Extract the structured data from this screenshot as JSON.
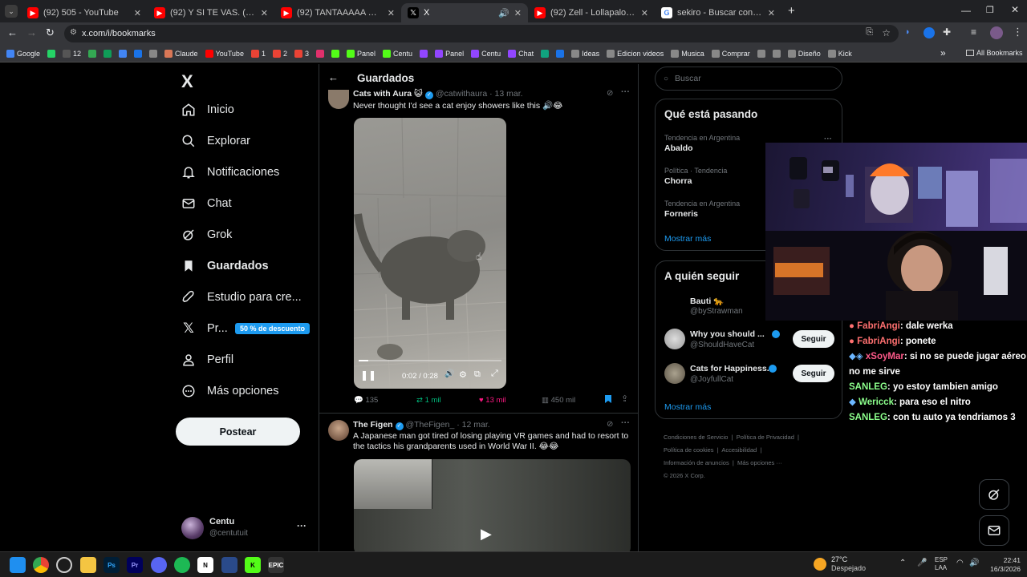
{
  "browser": {
    "tabs": [
      {
        "title": "(92) 505 - YouTube",
        "color": "#ff0000"
      },
      {
        "title": "(92) Y SI TE VAS. (VIDEO OFICIAL",
        "color": "#ff0000"
      },
      {
        "title": "(92) TANTAAAAA PLATAAA FT S",
        "color": "#ff0000"
      },
      {
        "title": "X",
        "color": "#000000"
      },
      {
        "title": "(92) Zell - Lollapalooza 2026 - Y",
        "color": "#ff0000"
      },
      {
        "title": "sekiro - Buscar con Google",
        "color": "#4285f4"
      }
    ],
    "new_tab": "+",
    "url": "x.com/i/bookmarks",
    "bookmarks": [
      {
        "label": "Google",
        "color": "#4285f4"
      },
      {
        "label": "",
        "color": "#25d366"
      },
      {
        "label": "12",
        "color": "#555"
      },
      {
        "label": "",
        "color": "#34a853"
      },
      {
        "label": "",
        "color": "#0f9d58"
      },
      {
        "label": "",
        "color": "#4285f4"
      },
      {
        "label": "",
        "color": "#1a73e8"
      },
      {
        "label": "",
        "color": "#888"
      },
      {
        "label": "Claude",
        "color": "#d97757"
      },
      {
        "label": "YouTube",
        "color": "#ff0000"
      },
      {
        "label": "1",
        "color": "#ea4335"
      },
      {
        "label": "2",
        "color": "#ea4335"
      },
      {
        "label": "3",
        "color": "#ea4335"
      },
      {
        "label": "",
        "color": "#e1306c"
      },
      {
        "label": "",
        "color": "#53fc18"
      },
      {
        "label": "Panel",
        "color": "#53fc18"
      },
      {
        "label": "Centu",
        "color": "#53fc18"
      },
      {
        "label": "",
        "color": "#9146ff"
      },
      {
        "label": "Panel",
        "color": "#9146ff"
      },
      {
        "label": "Centu",
        "color": "#9146ff"
      },
      {
        "label": "Chat",
        "color": "#9146ff"
      },
      {
        "label": "",
        "color": "#10a37f"
      },
      {
        "label": "",
        "color": "#1a73e8"
      },
      {
        "label": "Ideas",
        "color": "#888"
      },
      {
        "label": "Edicion videos",
        "color": "#888"
      },
      {
        "label": "Musica",
        "color": "#888"
      },
      {
        "label": "Comprar",
        "color": "#888"
      },
      {
        "label": "",
        "color": "#888"
      },
      {
        "label": "",
        "color": "#888"
      },
      {
        "label": "Diseño",
        "color": "#888"
      },
      {
        "label": "Kick",
        "color": "#888"
      }
    ],
    "more": "»",
    "all_bookmarks": "All Bookmarks"
  },
  "sidebar": {
    "logo": "X",
    "items": [
      {
        "label": "Inicio",
        "icon": "home-icon"
      },
      {
        "label": "Explorar",
        "icon": "search-icon"
      },
      {
        "label": "Notificaciones",
        "icon": "bell-icon"
      },
      {
        "label": "Chat",
        "icon": "mail-icon"
      },
      {
        "label": "Grok",
        "icon": "grok-icon"
      },
      {
        "label": "Guardados",
        "icon": "bookmark-icon"
      },
      {
        "label": "Estudio para cre...",
        "icon": "rocket-icon"
      },
      {
        "label": "Pr...",
        "icon": "x-icon"
      },
      {
        "label": "Perfil",
        "icon": "person-icon"
      },
      {
        "label": "Más opciones",
        "icon": "more-circle-icon"
      }
    ],
    "premium_badge": "50 % de descuento",
    "post_button": "Postear",
    "account": {
      "name": "Centu",
      "handle": "@centutuit",
      "more": "···"
    }
  },
  "main": {
    "back": "←",
    "title": "Guardados",
    "post1": {
      "author": "Cats with Aura 😺",
      "handle": "@catwithaura",
      "time": "· 13 mar.",
      "text": "Never thought I'd see a cat enjoy showers like this 🔊😂",
      "video_time": "0:02 / 0:28",
      "video_progress": 0.07,
      "replies": "135",
      "reposts": "1 mil",
      "likes": "13 mil",
      "views": "450 mil"
    },
    "post2": {
      "author": "The Figen",
      "handle": "@TheFigen_",
      "time": "· 12 mar.",
      "text": "A Japanese man got tired of losing playing VR games and had to resort to the tactics his grandparents used in World War II. 😂😂"
    }
  },
  "right": {
    "search_placeholder": "Buscar",
    "trends_title": "Qué está pasando",
    "trends": [
      {
        "context": "Tendencia en Argentina",
        "name": "Abaldo"
      },
      {
        "context": "Política · Tendencia",
        "name": "Chorra"
      },
      {
        "context": "Tendencia en Argentina",
        "name": "Forneris"
      }
    ],
    "show_more": "Mostrar más",
    "follow_title": "A quién seguir",
    "follow": [
      {
        "name": "Bauti 🐆",
        "handle": "@byStrawman"
      },
      {
        "name": "Why you should ...",
        "handle": "@ShouldHaveCat",
        "button": "Seguir"
      },
      {
        "name": "Cats for Happiness.",
        "handle": "@JoyfullCat",
        "button": "Seguir"
      }
    ],
    "follow_more": "Mostrar más",
    "footer": [
      "Condiciones de Servicio",
      "Política de Privacidad",
      "Política de cookies",
      "Accesibilidad",
      "Información de anuncios",
      "Más opciones ···",
      "© 2026 X Corp."
    ]
  },
  "chat": [
    {
      "user": "FabriAngi",
      "msg": ": dale werka",
      "color": "#ff7070"
    },
    {
      "user": "FabriAngi",
      "msg": ": ponete",
      "color": "#ff7070"
    },
    {
      "user": "xSoyMar",
      "msg": ": si no se puede jugar aéreo no me sirve",
      "color": "#ff5a8a"
    },
    {
      "user": "SANLEG",
      "msg": ": yo estoy tambien amigo",
      "color": "#8cff8c"
    },
    {
      "user": "Wericck",
      "msg": ": para eso el nitro",
      "color": "#8cff8c"
    },
    {
      "user": "SANLEG",
      "msg": ": con tu auto ya tendriamos 3",
      "color": "#8cff8c"
    }
  ],
  "taskbar": {
    "weather_temp": "27°C",
    "weather_desc": "Despejado",
    "lang1": "ESP",
    "lang2": "LAA",
    "time": "22:41",
    "date": "16/3/2026"
  }
}
